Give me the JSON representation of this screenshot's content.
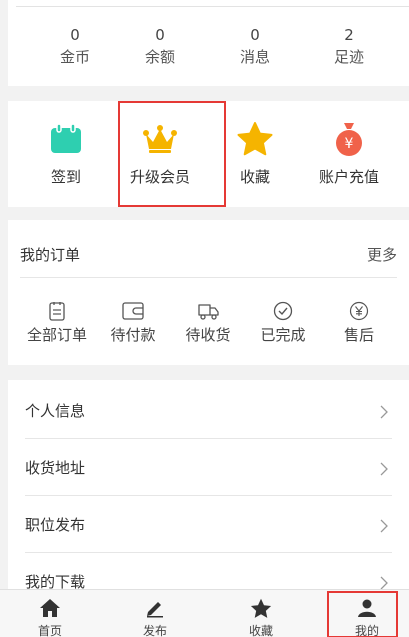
{
  "stats": [
    {
      "value": "0",
      "label": "金币"
    },
    {
      "value": "0",
      "label": "余额"
    },
    {
      "value": "0",
      "label": "消息"
    },
    {
      "value": "2",
      "label": "足迹"
    }
  ],
  "features": [
    {
      "label": "签到",
      "icon": "calendar-icon",
      "color": "#2ecfb0"
    },
    {
      "label": "升级会员",
      "icon": "crown-icon",
      "color": "#f5b400"
    },
    {
      "label": "收藏",
      "icon": "star-icon",
      "color": "#f5b400"
    },
    {
      "label": "账户充值",
      "icon": "money-bag-icon",
      "color": "#f0624a"
    }
  ],
  "orders": {
    "title": "我的订单",
    "more": "更多",
    "items": [
      {
        "label": "全部订单",
        "icon": "clipboard-icon"
      },
      {
        "label": "待付款",
        "icon": "wallet-icon"
      },
      {
        "label": "待收货",
        "icon": "truck-icon"
      },
      {
        "label": "已完成",
        "icon": "check-circle-icon"
      },
      {
        "label": "售后",
        "icon": "yen-circle-icon"
      }
    ]
  },
  "menu": [
    {
      "label": "个人信息"
    },
    {
      "label": "收货地址"
    },
    {
      "label": "职位发布"
    },
    {
      "label": "我的下载"
    }
  ],
  "tabs": [
    {
      "label": "首页",
      "icon": "home-icon"
    },
    {
      "label": "发布",
      "icon": "pencil-icon"
    },
    {
      "label": "收藏",
      "icon": "star-icon"
    },
    {
      "label": "我的",
      "icon": "user-icon"
    }
  ],
  "colors": {
    "highlight": "#e53935",
    "accent_teal": "#2ecfb0",
    "accent_gold": "#f5b400",
    "accent_red": "#f0624a"
  }
}
